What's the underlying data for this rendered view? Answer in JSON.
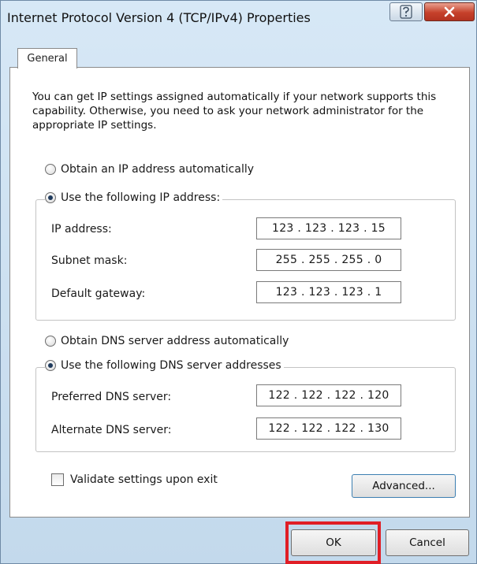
{
  "window": {
    "title": "Internet Protocol Version 4 (TCP/IPv4) Properties",
    "help_icon": "help-icon",
    "close_icon": "close-icon"
  },
  "tabs": [
    "General"
  ],
  "intro_text": "You can get IP settings assigned automatically if your network supports this capability. Otherwise, you need to ask your network administrator for the appropriate IP settings.",
  "ip_section": {
    "auto_label": "Obtain an IP address automatically",
    "manual_label": "Use the following IP address:",
    "selected": "manual",
    "fields": [
      {
        "label": "IP address:",
        "value": "123 . 123 . 123 . 15"
      },
      {
        "label": "Subnet mask:",
        "value": "255 . 255 . 255 .  0"
      },
      {
        "label": "Default gateway:",
        "value": "123 . 123 . 123 .  1"
      }
    ]
  },
  "dns_section": {
    "auto_label": "Obtain DNS server address automatically",
    "manual_label": "Use the following DNS server addresses",
    "selected": "manual",
    "fields": [
      {
        "label": "Preferred DNS server:",
        "value": "122 . 122 . 122 . 120"
      },
      {
        "label": "Alternate DNS server:",
        "value": "122 . 122 . 122 . 130"
      }
    ]
  },
  "validate_label": "Validate settings upon exit",
  "validate_checked": false,
  "buttons": {
    "advanced": "Advanced...",
    "ok": "OK",
    "cancel": "Cancel"
  },
  "colors": {
    "highlight": "#e01e26",
    "close_button": "#c6412b"
  }
}
